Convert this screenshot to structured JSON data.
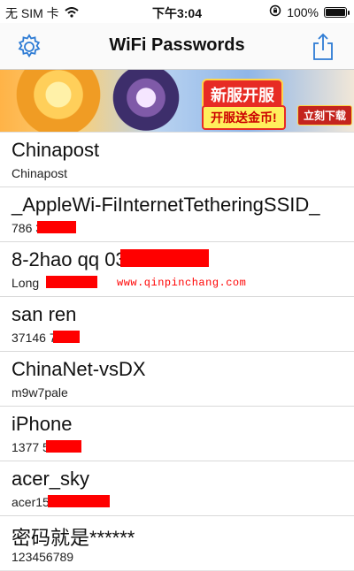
{
  "status_bar": {
    "carrier": "无 SIM 卡",
    "time": "下午3:04",
    "battery_text": "100%",
    "battery_level": 1.0
  },
  "nav": {
    "title": "WiFi Passwords",
    "left_icon": "gear-icon",
    "right_icon": "share-icon"
  },
  "banner": {
    "title": "新服开服",
    "subtitle": "开服送金币!",
    "button": "立刻下载"
  },
  "watermark": "www.qinpinchang.com",
  "networks": [
    {
      "ssid": "Chinapost",
      "password": "Chinapost"
    },
    {
      "ssid": "_AppleWi-FiInternetTetheringSSID_",
      "password": "786       3"
    },
    {
      "ssid": "8-2hao  qq         03",
      "password": "Long"
    },
    {
      "ssid": "san  ren",
      "password": "37146      7"
    },
    {
      "ssid": "ChinaNet-vsDX",
      "password": "m9w7pale"
    },
    {
      "ssid": "iPhone",
      "password": "1377        579"
    },
    {
      "ssid": "acer_sky",
      "password": "acer15         2252s.."
    },
    {
      "ssid": "密码就是******",
      "password": "123456789"
    }
  ],
  "colors": {
    "redaction": "#ff0000",
    "ios_blue": "#2d7bd4"
  }
}
